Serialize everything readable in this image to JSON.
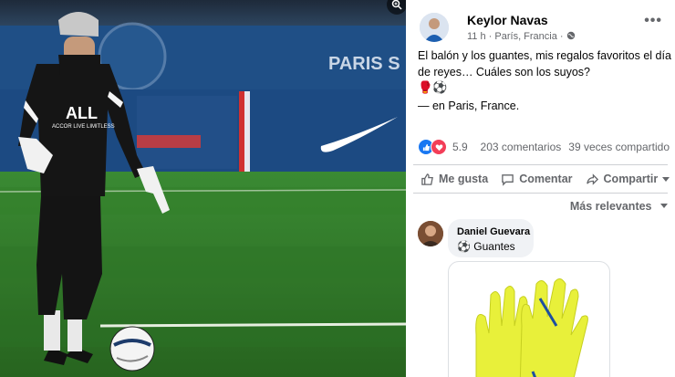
{
  "post": {
    "author": "Keylor Navas",
    "time": "11 h",
    "location_meta": "París, Francia",
    "separator": "·",
    "text": "El balón y los guantes, mis regalos favoritos el día de reyes… Cuáles son los suyos?",
    "emojis": "🥊⚽",
    "location_prefix": "— en",
    "location_name": "Paris, France",
    "location_suffix": ".",
    "more_icon": "•••"
  },
  "stats": {
    "reactions_count": "5.9",
    "comments": "203 comentarios",
    "shares": "39 veces compartido"
  },
  "actions": {
    "like": "Me gusta",
    "comment": "Comentar",
    "share": "Compartir"
  },
  "sort": {
    "label": "Más relevantes"
  },
  "comment": {
    "name": "Daniel Guevara",
    "emoji": "⚽",
    "text": "Guantes"
  },
  "photo": {
    "board_text": "PARIS S",
    "shirt_text": "ALL",
    "shirt_sub": "ACCOR LIVE LIMITLESS"
  },
  "colors": {
    "brand_blue": "#1877f2",
    "love_red": "#f33e58",
    "glove_yellow": "#e8f03a",
    "pitch_green": "#2f7a2b"
  }
}
